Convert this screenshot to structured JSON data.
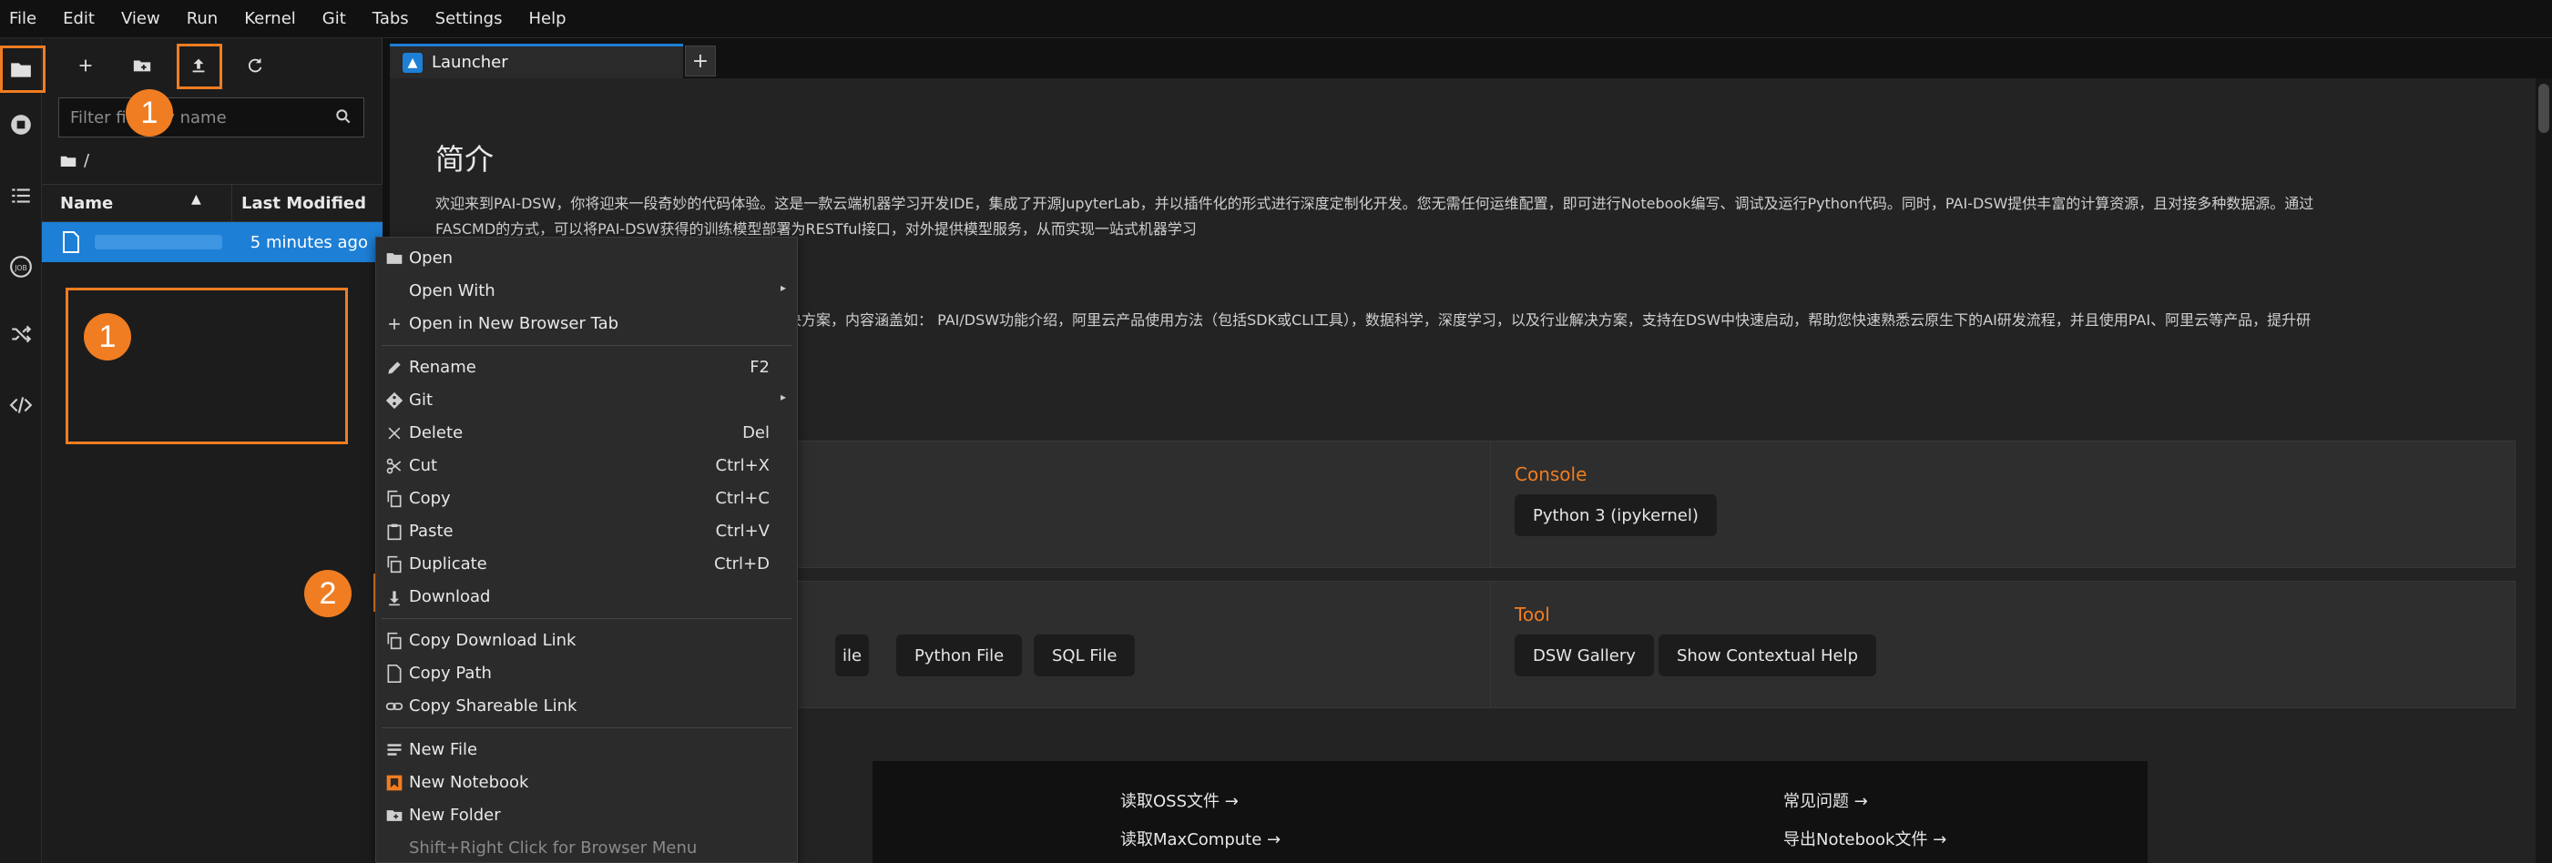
{
  "menubar": {
    "items": [
      "File",
      "Edit",
      "View",
      "Run",
      "Kernel",
      "Git",
      "Tabs",
      "Settings",
      "Help"
    ]
  },
  "activity_bar": {
    "icons": [
      "folder-icon",
      "stop-circle-icon",
      "list-icon",
      "job-icon",
      "shuffle-icon",
      "code-icon"
    ]
  },
  "filebrowser": {
    "filter_placeholder": "Filter files by name",
    "breadcrumb": "/",
    "columns": {
      "name": "Name",
      "modified": "Last Modified"
    },
    "file": {
      "name": "",
      "modified": "5 minutes ago"
    }
  },
  "annotations": {
    "step1": "1",
    "step2": "2"
  },
  "tabs": [
    {
      "label": "Launcher"
    }
  ],
  "tab_add_label": "+",
  "launcher": {
    "intro_title": "简介",
    "intro_line1": "欢迎来到PAI-DSW，你将迎来一段奇妙的代码体验。这是一款云端机器学习开发IDE，集成了开源JupyterLab，并以插件化的形式进行深度定制化开发。您无需任何运维配置，即可进行Notebook编写、调试及运行Python代码。同时，PAI-DSW提供丰富的计算资源，且对接多种数据源。通过",
    "intro_line2": "FASCMD的方式，可以将PAI-DSW获得的训练模型部署为RESTful接口，对外提供模型服务，从而实现一站式机器学习",
    "intro_line3": "决方案，内容涵盖如： PAI/DSW功能介绍，阿里云产品使用方法（包括SDK或CLI工具），数据科学，深度学习，以及行业解决方案，支持在DSW中快速启动，帮助您快速熟悉云原生下的AI研发流程，并且使用PAI、阿里云等产品，提升研",
    "console": {
      "title": "Console",
      "items": [
        "Python 3 (ipykernel)"
      ]
    },
    "other": {
      "items": [
        "ile",
        "Python File",
        "SQL File"
      ]
    },
    "tool": {
      "title": "Tool",
      "items": [
        "DSW Gallery",
        "Show Contextual Help"
      ]
    },
    "links": [
      "读取OSS文件 →",
      "读取MaxCompute →",
      "常见问题 →",
      "导出Notebook文件 →"
    ]
  },
  "context_menu": {
    "items": [
      {
        "label": "Open",
        "key": "",
        "sub": false,
        "icon": "folder-icon"
      },
      {
        "label": "Open With",
        "key": "",
        "sub": true,
        "icon": ""
      },
      {
        "label": "Open in New Browser Tab",
        "key": "",
        "sub": false,
        "icon": "plus-icon"
      },
      {
        "label": "Rename",
        "key": "F2",
        "sub": false,
        "icon": "pencil-icon"
      },
      {
        "label": "Git",
        "key": "",
        "sub": true,
        "icon": "git-icon"
      },
      {
        "label": "Delete",
        "key": "Del",
        "sub": false,
        "icon": "close-icon"
      },
      {
        "label": "Cut",
        "key": "Ctrl+X",
        "sub": false,
        "icon": "scissors-icon"
      },
      {
        "label": "Copy",
        "key": "Ctrl+C",
        "sub": false,
        "icon": "copy-icon"
      },
      {
        "label": "Paste",
        "key": "Ctrl+V",
        "sub": false,
        "icon": "paste-icon"
      },
      {
        "label": "Duplicate",
        "key": "Ctrl+D",
        "sub": false,
        "icon": "duplicate-icon"
      },
      {
        "label": "Download",
        "key": "",
        "sub": false,
        "icon": "download-icon"
      },
      {
        "label": "Copy Download Link",
        "key": "",
        "sub": false,
        "icon": "copy-icon"
      },
      {
        "label": "Copy Path",
        "key": "",
        "sub": false,
        "icon": "file-icon"
      },
      {
        "label": "Copy Shareable Link",
        "key": "",
        "sub": false,
        "icon": "link-icon"
      },
      {
        "label": "New File",
        "key": "",
        "sub": false,
        "icon": "text-file-icon"
      },
      {
        "label": "New Notebook",
        "key": "",
        "sub": false,
        "icon": "notebook-icon"
      },
      {
        "label": "New Folder",
        "key": "",
        "sub": false,
        "icon": "new-folder-icon"
      },
      {
        "label": "Shift+Right Click for Browser Menu",
        "key": "",
        "sub": false,
        "icon": ""
      }
    ]
  },
  "colors": {
    "accent": "#1d7fd6",
    "annotation": "#f07d22",
    "section_title": "#f07d22"
  }
}
